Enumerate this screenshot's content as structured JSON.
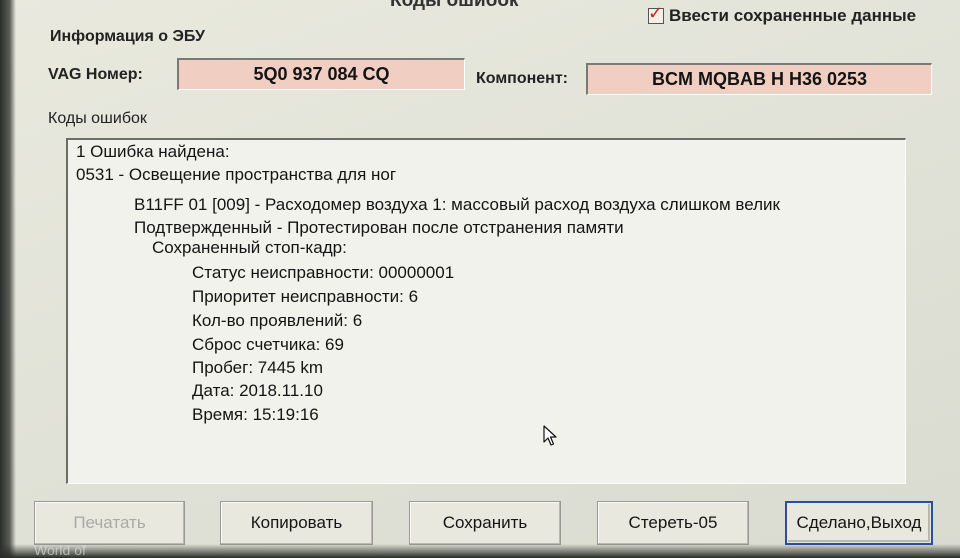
{
  "window": {
    "title": "Коды ошибок"
  },
  "save_data_checkbox": {
    "label": "Ввести сохраненные данные",
    "checked": true
  },
  "ecu_info": {
    "group_label": "Информация о ЭБУ",
    "vag_number_label": "VAG Номер:",
    "vag_number_value": "5Q0 937 084 CQ",
    "component_label": "Компонент:",
    "component_value": "BCM MQBAB H   H36 0253"
  },
  "fault_codes": {
    "group_label": "Коды ошибок",
    "lines": [
      "1 Ошибка найдена:",
      "0531 - Освещение пространства для ног",
      "B11FF 01 [009] - Расходомер воздуха 1: массовый расход воздуха слишком велик",
      "Подтвержденный - Протестирован после отстранения памяти",
      "Сохраненный стоп-кадр:",
      "Статус неисправности: 00000001",
      "Приоритет неисправности: 6",
      "Кол-во проявлений: 6",
      "Сброс счетчика: 69",
      "Пробег: 7445 km",
      "Дата: 2018.11.10",
      "Время: 15:19:16"
    ]
  },
  "buttons": {
    "print": "Печатать",
    "copy": "Копировать",
    "save": "Сохранить",
    "clear": "Стереть-05",
    "done": "Сделано,Выход"
  },
  "footer": {
    "text": "World of"
  },
  "colors": {
    "field_background": "#f0cfc2",
    "check_color": "#c2271c",
    "default_button_border": "#2a4f9e"
  }
}
